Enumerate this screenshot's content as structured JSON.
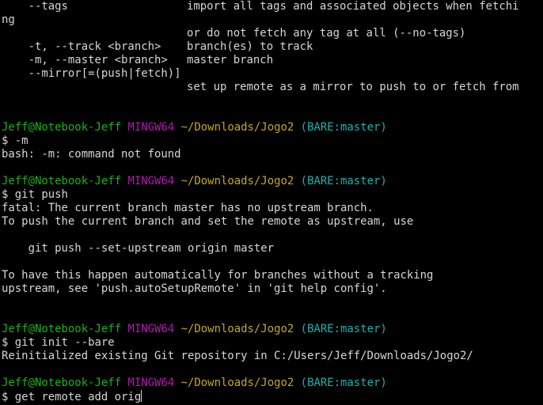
{
  "help": {
    "tags_opt": "    --tags",
    "tags_desc": "import all tags and associated objects when fetchi",
    "tags_wrap": "ng",
    "tags_desc2": "or do not fetch any tag at all (--no-tags)",
    "track_opt": "    -t, --track <branch>",
    "track_desc": "branch(es) to track",
    "master_opt": "    -m, --master <branch>",
    "master_desc": "master branch",
    "mirror_opt": "    --mirror[=(push|fetch)]",
    "mirror_desc": "set up remote as a mirror to push to or fetch from"
  },
  "prompt": {
    "user": "Jeff@Notebook-Jeff",
    "system": "MINGW64",
    "path": "~/Downloads/Jogo2",
    "branch": "(BARE:master)"
  },
  "session": [
    {
      "command": "$ -m",
      "output": [
        "bash: -m: command not found"
      ]
    },
    {
      "command": "$ git push",
      "output": [
        "fatal: The current branch master has no upstream branch.",
        "To push the current branch and set the remote as upstream, use",
        "",
        "    git push --set-upstream origin master",
        "",
        "To have this happen automatically for branches without a tracking",
        "upstream, see 'push.autoSetupRemote' in 'git help config'."
      ]
    },
    {
      "command": "$ git init --bare",
      "output": [
        "Reinitialized existing Git repository in C:/Users/Jeff/Downloads/Jogo2/"
      ]
    },
    {
      "command": "$ get remote add orig",
      "output": []
    }
  ],
  "colors": {
    "background": "#000000",
    "text": "#d6d6d6",
    "user": "#18b218",
    "system": "#b218b2",
    "path": "#c5a81b",
    "branch": "#18b2b2"
  }
}
